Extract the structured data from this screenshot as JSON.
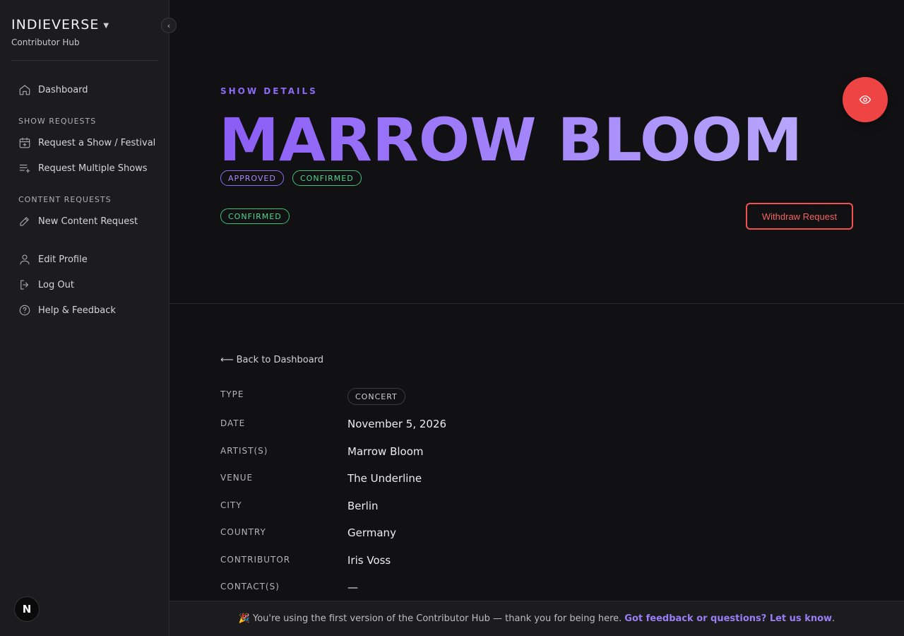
{
  "sidebar": {
    "brand": "INDIEVERSE",
    "subbrand": "Contributor Hub",
    "nav": {
      "dashboard": "Dashboard",
      "show_requests_heading": "SHOW REQUESTS",
      "request_show": "Request a Show / Festival",
      "request_multiple": "Request Multiple Shows",
      "content_requests_heading": "CONTENT REQUESTS",
      "new_content": "New Content Request",
      "edit_profile": "Edit Profile",
      "log_out": "Log Out",
      "help": "Help & Feedback"
    },
    "badge": "N"
  },
  "hero": {
    "eyebrow": "SHOW DETAILS",
    "title": "MARROW BLOOM",
    "status_pills": [
      "APPROVED",
      "CONFIRMED"
    ],
    "secondary_pill": "CONFIRMED",
    "withdraw_label": "Withdraw Request"
  },
  "details": {
    "back_label": "Back to Dashboard",
    "rows": {
      "type": {
        "label": "TYPE",
        "value": "CONCERT"
      },
      "date": {
        "label": "DATE",
        "value": "November 5, 2026"
      },
      "artists": {
        "label": "ARTIST(S)",
        "value": "Marrow Bloom"
      },
      "venue": {
        "label": "VENUE",
        "value": "The Underline"
      },
      "city": {
        "label": "CITY",
        "value": "Berlin"
      },
      "country": {
        "label": "COUNTRY",
        "value": "Germany"
      },
      "contributor": {
        "label": "CONTRIBUTOR",
        "value": "Iris Voss"
      },
      "contacts": {
        "label": "CONTACT(S)",
        "value": "—"
      }
    }
  },
  "footer": {
    "emoji": "🎉",
    "message": "You're using the first version of the Contributor Hub — thank you for being here.",
    "link": "Got feedback or questions? Let us know",
    "trailing": "."
  },
  "colors": {
    "accent_violet": "#8b6cf6",
    "success_green": "#3fbf7a",
    "danger_red": "#ef4444"
  }
}
